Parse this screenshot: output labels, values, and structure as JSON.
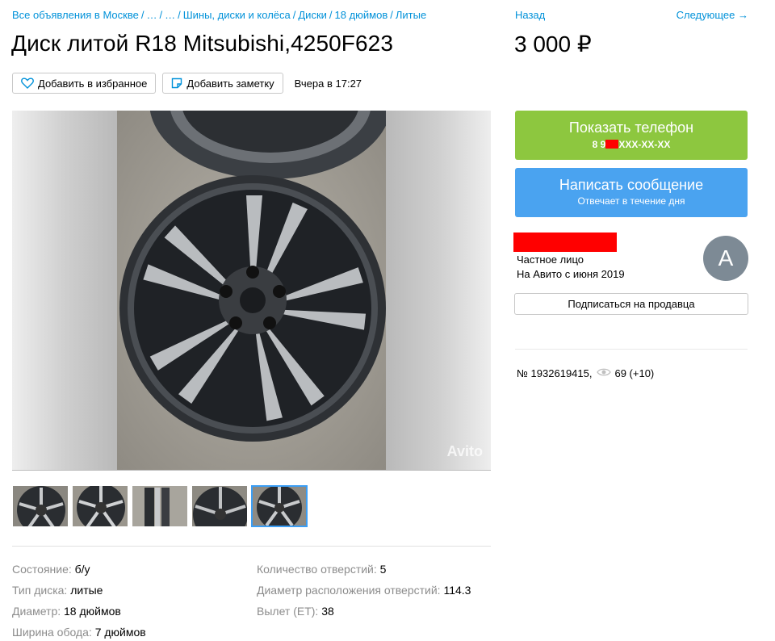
{
  "breadcrumbs": [
    "Все объявления в Москве",
    "…",
    "…",
    "Шины, диски и колёса",
    "Диски",
    "18 дюймов",
    "Литые"
  ],
  "nav": {
    "prev": "Назад",
    "next": "Следующее →"
  },
  "title": "Диск литой R18 Mitsubishi,4250F623",
  "price": "3 000 ₽",
  "actions": {
    "favorite": "Добавить в избранное",
    "note": "Добавить заметку",
    "posted": "Вчера в 17:27"
  },
  "gallery": {
    "watermark": "Avito",
    "thumb_count": 5,
    "active_thumb": 5
  },
  "params": [
    {
      "key": "Состояние: ",
      "value": "б/у"
    },
    {
      "key": "Тип диска: ",
      "value": "литые"
    },
    {
      "key": "Диаметр: ",
      "value": "18 дюймов"
    },
    {
      "key": "Ширина обода: ",
      "value": "7 дюймов"
    },
    {
      "key": "Количество отверстий: ",
      "value": "5"
    },
    {
      "key": "Диаметр расположения отверстий: ",
      "value": "114.3"
    },
    {
      "key": "Вылет (ET): ",
      "value": "38"
    }
  ],
  "contact": {
    "phone_label": "Показать телефон",
    "phone_prefix": "8 9",
    "phone_suffix": "XXX-XX-XX",
    "message_label": "Написать сообщение",
    "message_sub": "Отвечает в течение дня"
  },
  "seller": {
    "type": "Частное лицо",
    "since": "На Авито с июня 2019",
    "avatar_letter": "А",
    "subscribe": "Подписаться на продавца"
  },
  "listing": {
    "number": "№ 1932619415,",
    "views": "69 (+10)"
  },
  "colors": {
    "link": "#0091d9",
    "phone_btn": "#8dc73f",
    "msg_btn": "#4aa3f0",
    "avatar": "#7d8a95",
    "redaction": "#ff0000"
  }
}
